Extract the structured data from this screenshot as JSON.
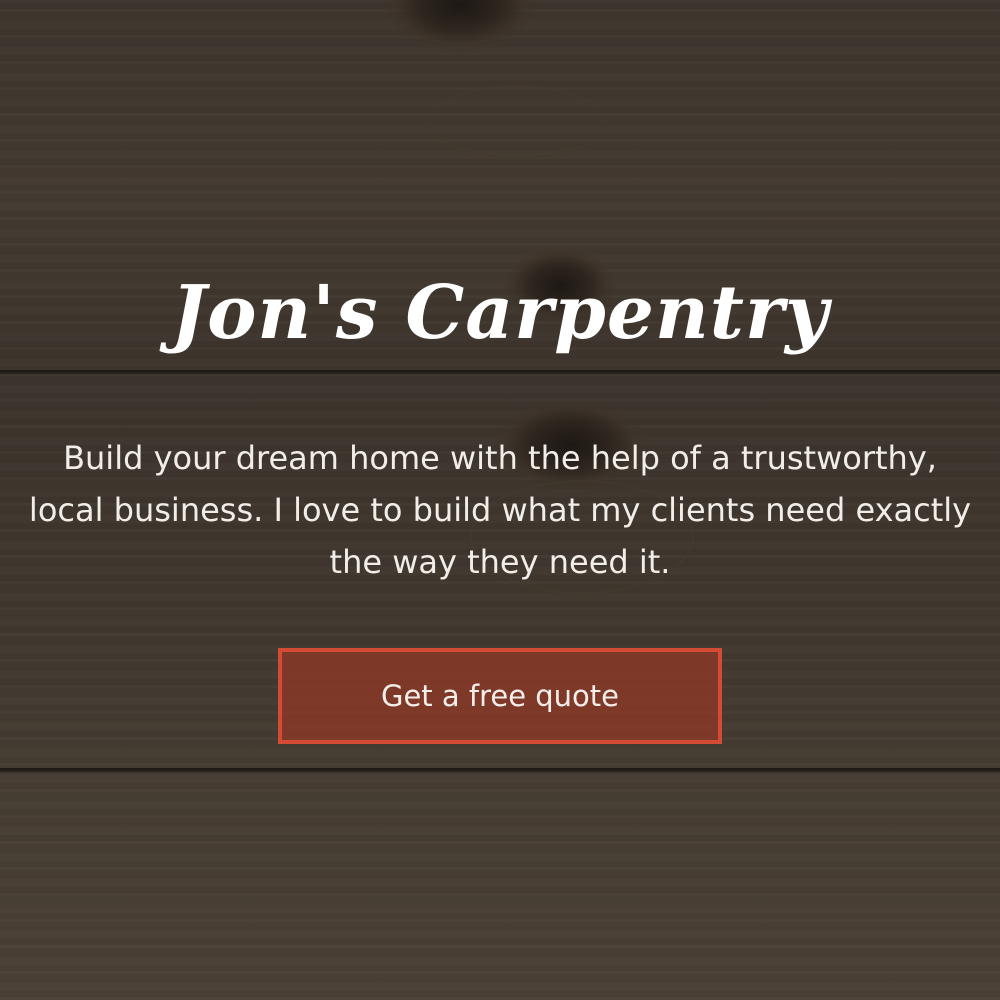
{
  "hero": {
    "title": "Jon's Carpentry",
    "subtitle": "Build your dream home with the help of a trustworthy,\nlocal business. I love to build what my clients need exactly\nthe way they need it.",
    "cta_label": "Get a free quote"
  },
  "colors": {
    "accent": "#d24b32",
    "button_fill": "#8f3827",
    "text": "#ffffff",
    "background": "#3b342d"
  }
}
